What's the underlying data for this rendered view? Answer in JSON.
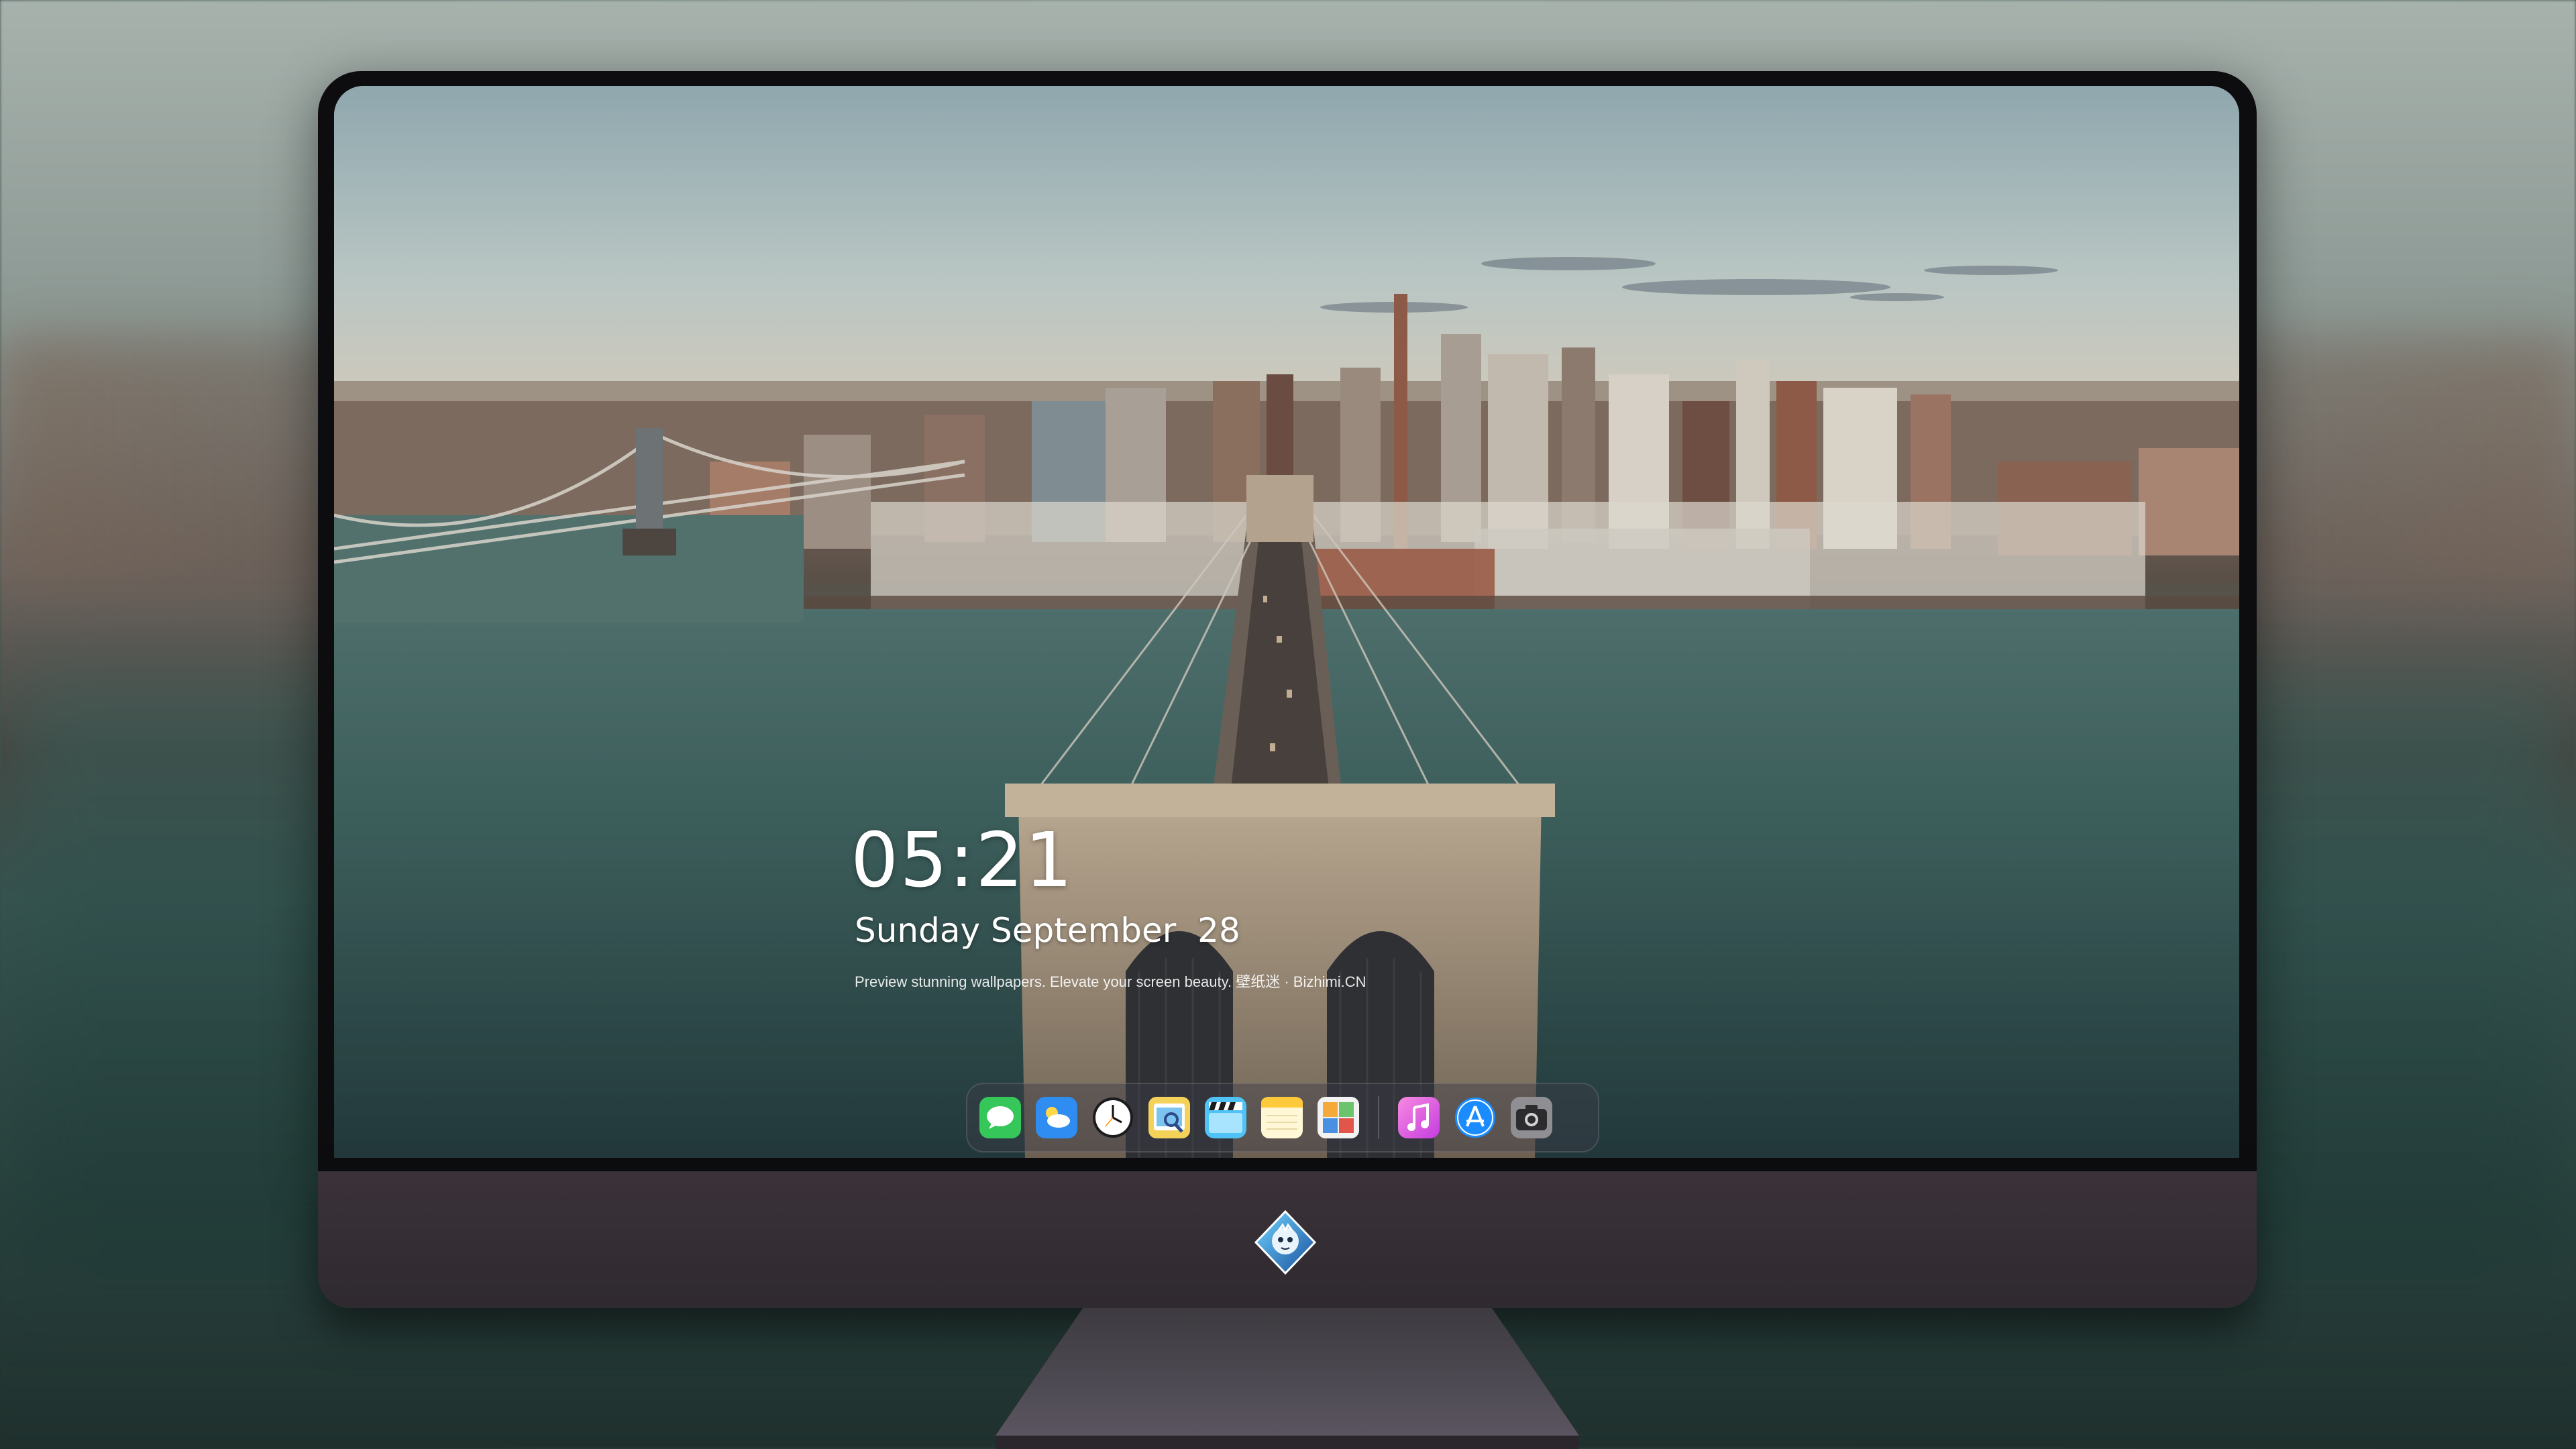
{
  "clock": {
    "time": "05:21",
    "date": "Sunday September  28",
    "tagline": "Preview stunning wallpapers. Elevate your screen beauty. 壁纸迷 · Bizhimi.CN"
  },
  "dock": {
    "apps": [
      {
        "icon": "messages-icon",
        "label": "Messages"
      },
      {
        "icon": "weather-icon",
        "label": "Weather"
      },
      {
        "icon": "clock-icon",
        "label": "Clock"
      },
      {
        "icon": "preview-icon",
        "label": "Preview"
      },
      {
        "icon": "clips-icon",
        "label": "Clips"
      },
      {
        "icon": "notes-icon",
        "label": "Notes"
      },
      {
        "icon": "photo-booth-icon",
        "label": "Photo Booth"
      },
      {
        "icon": "music-icon",
        "label": "Music"
      },
      {
        "icon": "app-store-icon",
        "label": "App Store"
      },
      {
        "icon": "camera-icon",
        "label": "Camera"
      }
    ]
  },
  "colors": {
    "bezel": "#0d0d10",
    "chin": "#332c33",
    "text": "#ffffff"
  }
}
